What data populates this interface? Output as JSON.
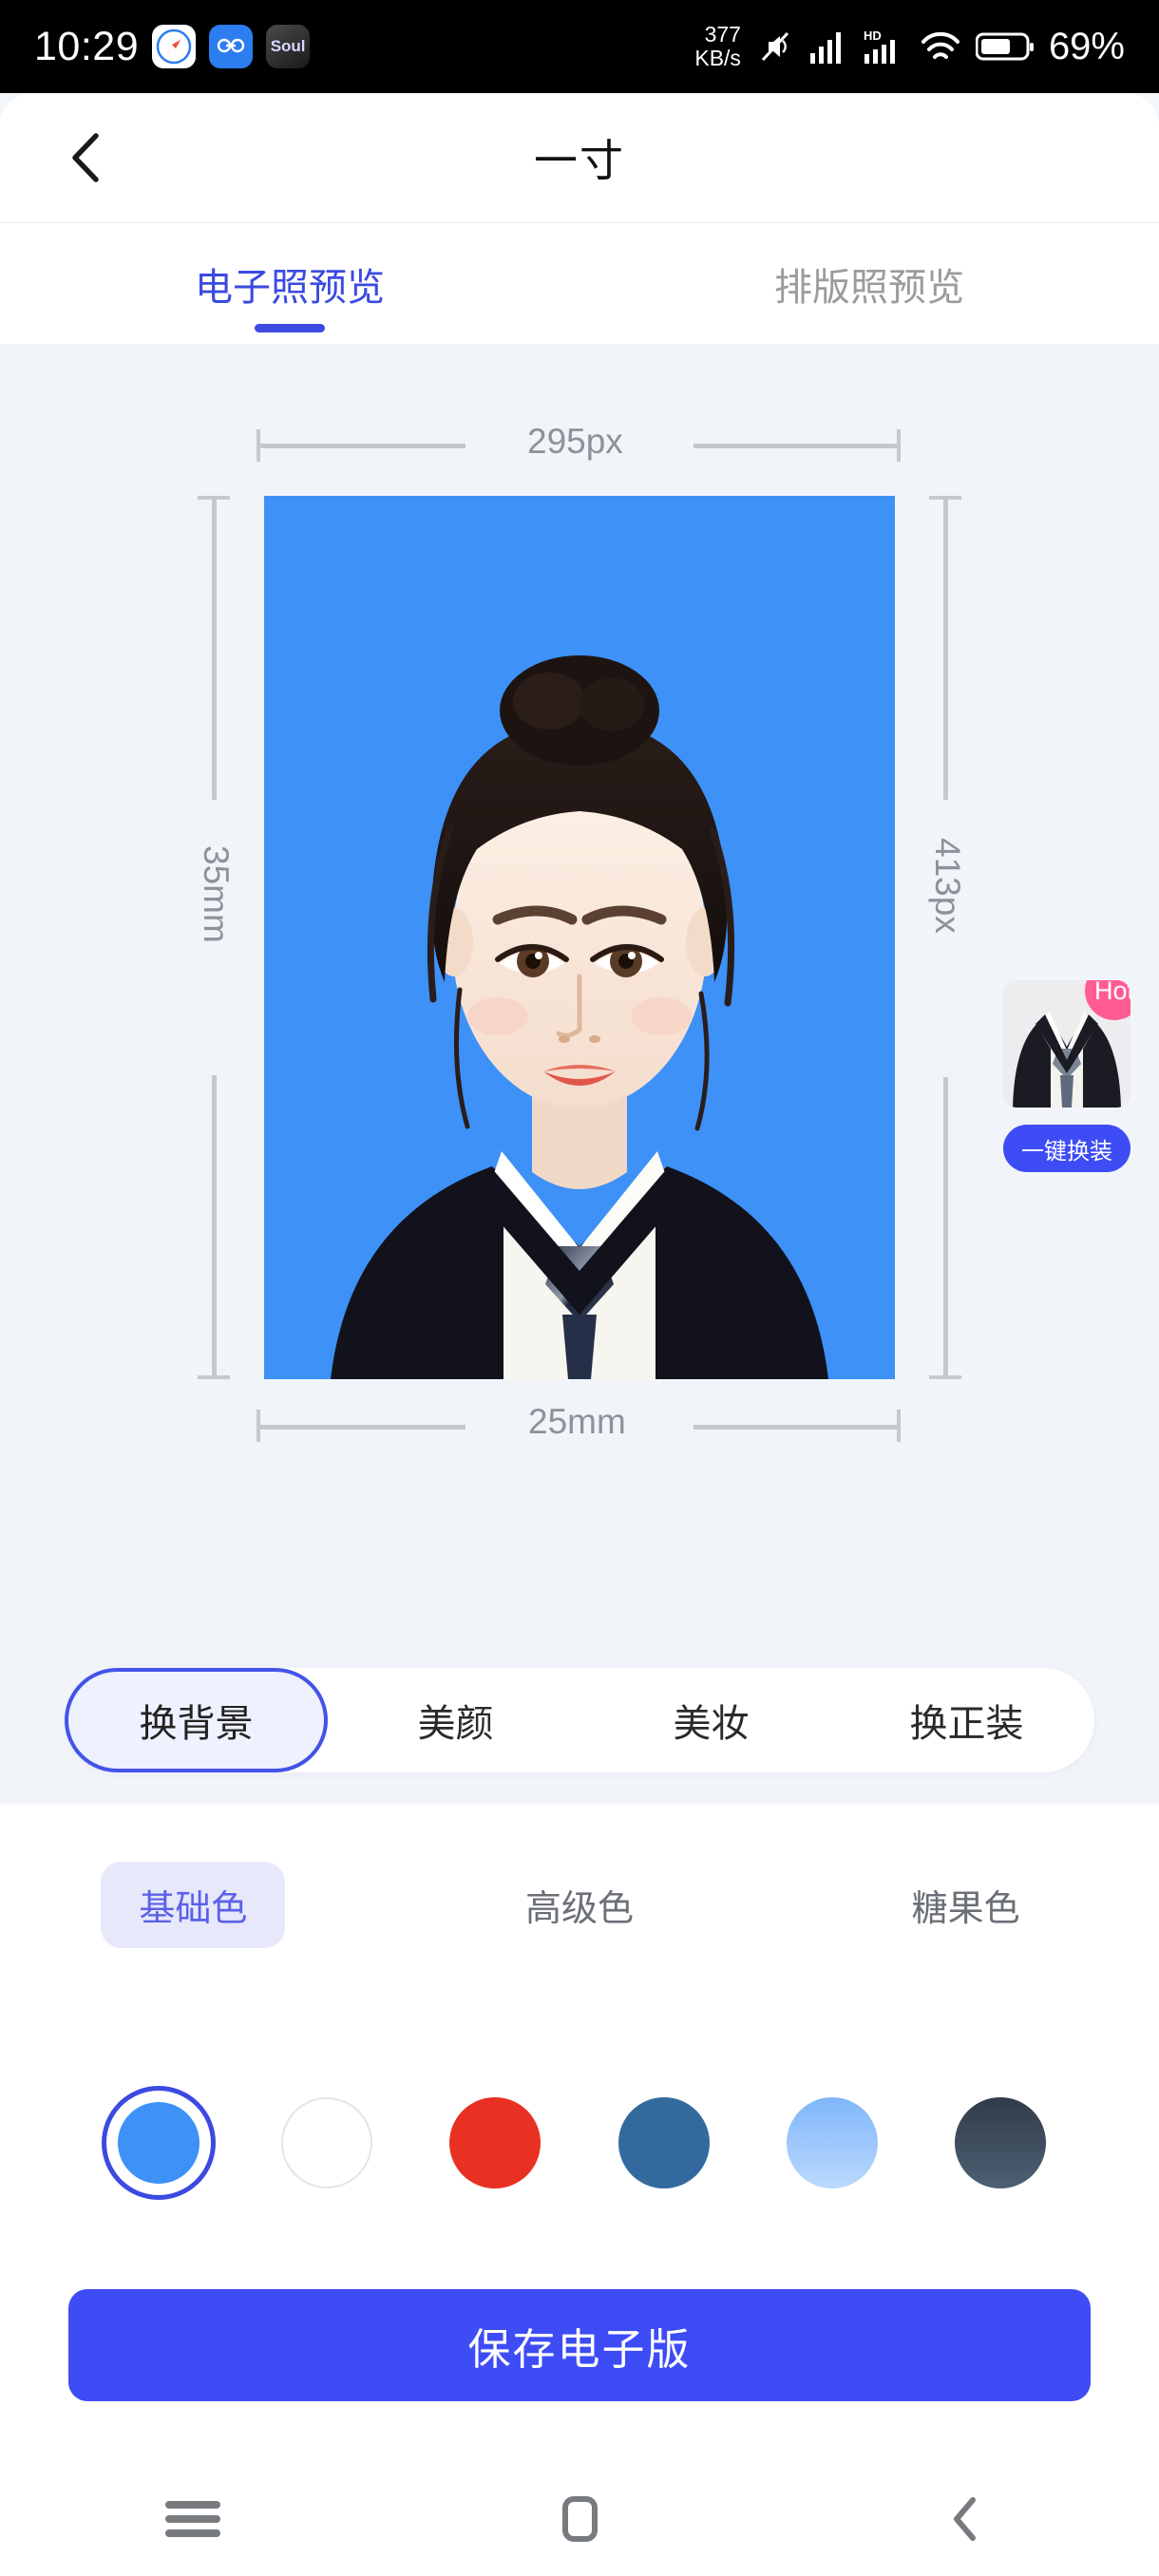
{
  "status_bar": {
    "time": "10:29",
    "app_icons": [
      "safari-icon",
      "blue-infinity-icon",
      "soul-app-icon"
    ],
    "soul_label": "Soul",
    "network_speed_value": "377",
    "network_speed_unit": "KB/s",
    "icons": [
      "mute-icon",
      "signal-bars-icon",
      "hd-icon",
      "signal-bars-2-icon",
      "wifi-icon",
      "battery-icon"
    ],
    "hd_label": "HD",
    "battery_percent": "69%"
  },
  "header": {
    "back_icon": "chevron-left-icon",
    "title": "一寸"
  },
  "tabs": [
    {
      "label": "电子照预览",
      "active": true
    },
    {
      "label": "排版照预览",
      "active": false
    }
  ],
  "preview": {
    "width_px_label": "295px",
    "height_px_label": "413px",
    "width_mm_label": "25mm",
    "height_mm_label": "35mm",
    "background_color": "#3d91f7"
  },
  "outfit_widget": {
    "badge": "Hot",
    "badge_color": "#ff5c93",
    "button_label": "一键换装",
    "button_color": "#3d4cf5",
    "thumb_name": "suit-thumbnail"
  },
  "edit_tools": [
    {
      "label": "换背景",
      "active": true
    },
    {
      "label": "美颜",
      "active": false
    },
    {
      "label": "美妆",
      "active": false
    },
    {
      "label": "换正装",
      "active": false
    }
  ],
  "color_categories": [
    {
      "label": "基础色",
      "active": true
    },
    {
      "label": "高级色",
      "active": false
    },
    {
      "label": "糖果色",
      "active": false
    }
  ],
  "color_swatches": [
    {
      "name": "blue",
      "color": "#3d91f7",
      "selected": true
    },
    {
      "name": "white",
      "color": "#ffffff",
      "selected": false
    },
    {
      "name": "red",
      "color": "#e83122",
      "selected": false
    },
    {
      "name": "steel-blue",
      "color": "#336a9e",
      "selected": false
    },
    {
      "name": "light-blue",
      "color": "#9fc8fb",
      "selected": false
    },
    {
      "name": "dark-slate",
      "color": "#3b4b5c",
      "selected": false
    }
  ],
  "save_button": {
    "label": "保存电子版",
    "color": "#3d4cf5"
  },
  "nav_bar": {
    "recents_icon": "menu-icon",
    "home_icon": "home-square-icon",
    "back_icon": "chevron-left-icon"
  }
}
